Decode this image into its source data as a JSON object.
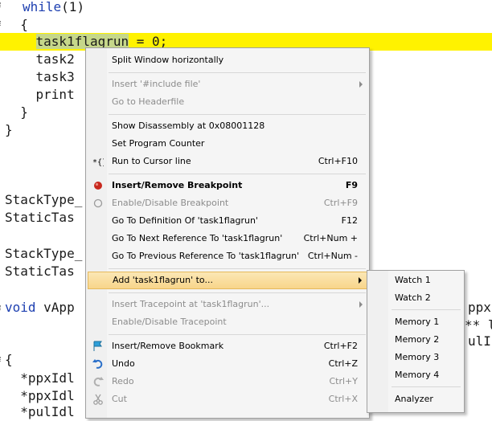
{
  "editor": {
    "lines": [
      {
        "kw": "while",
        "rest": "(1)"
      },
      {
        "text": "  {"
      },
      {
        "pre": "    ",
        "hl": "task1flagrun",
        "post": " = 0;"
      },
      {
        "text": "    task2"
      },
      {
        "text": "    task3"
      },
      {
        "text": "    print"
      },
      {
        "text": "  }"
      },
      {
        "text": "}"
      },
      {
        "text": "StackType_"
      },
      {
        "text": "StaticTas"
      },
      {
        "text": "StackType_"
      },
      {
        "text": "StaticTas"
      },
      {
        "kw": "void",
        "rest": " vApp"
      },
      {
        "text": "{"
      },
      {
        "text": "  *ppxIdl"
      },
      {
        "text": "  *ppxIdl"
      },
      {
        "text": "  *pulIdl"
      }
    ],
    "right_fragments": {
      "ppx": "ppx",
      "stars": "** l",
      "pulI": "ulI"
    }
  },
  "context_menu": {
    "items": [
      {
        "label": "Split Window horizontally",
        "disabled": false
      },
      {
        "label": "Insert '#include file'",
        "disabled": true,
        "submenu": true
      },
      {
        "label": "Go to Headerfile",
        "disabled": true
      },
      {
        "label": "Show Disassembly at 0x08001128",
        "disabled": false
      },
      {
        "label": "Set Program Counter",
        "disabled": false
      },
      {
        "label": "Run to Cursor line",
        "shortcut": "Ctrl+F10",
        "disabled": false,
        "icon": "run-to-cursor-icon"
      },
      {
        "label": "Insert/Remove Breakpoint",
        "shortcut": "F9",
        "bold": true,
        "icon": "breakpoint-icon"
      },
      {
        "label": "Enable/Disable Breakpoint",
        "shortcut": "Ctrl+F9",
        "disabled": true,
        "icon": "breakpoint-disabled-icon"
      },
      {
        "label": "Go To Definition Of 'task1flagrun'",
        "shortcut": "F12"
      },
      {
        "label": "Go To Next Reference To 'task1flagrun'",
        "shortcut": "Ctrl+Num +"
      },
      {
        "label": "Go To Previous Reference To 'task1flagrun'",
        "shortcut": "Ctrl+Num -"
      },
      {
        "label": "Add 'task1flagrun' to...",
        "submenu": true,
        "active": true
      },
      {
        "label": "Insert Tracepoint at 'task1flagrun'...",
        "disabled": true,
        "submenu": true
      },
      {
        "label": "Enable/Disable Tracepoint",
        "disabled": true
      },
      {
        "label": "Insert/Remove Bookmark",
        "shortcut": "Ctrl+F2",
        "icon": "bookmark-icon"
      },
      {
        "label": "Undo",
        "shortcut": "Ctrl+Z",
        "icon": "undo-icon"
      },
      {
        "label": "Redo",
        "shortcut": "Ctrl+Y",
        "disabled": true,
        "icon": "redo-icon"
      },
      {
        "label": "Cut",
        "shortcut": "Ctrl+X",
        "disabled": true,
        "icon": "cut-icon"
      }
    ]
  },
  "submenu": {
    "items": [
      "Watch 1",
      "Watch 2",
      "Memory 1",
      "Memory 2",
      "Memory 3",
      "Memory 4",
      "Analyzer"
    ]
  },
  "colors": {
    "current_line": "#fff200",
    "highlight_word": "#c6d78a",
    "keyword": "#1d3fb0",
    "menu_active": "#f8d58a"
  }
}
